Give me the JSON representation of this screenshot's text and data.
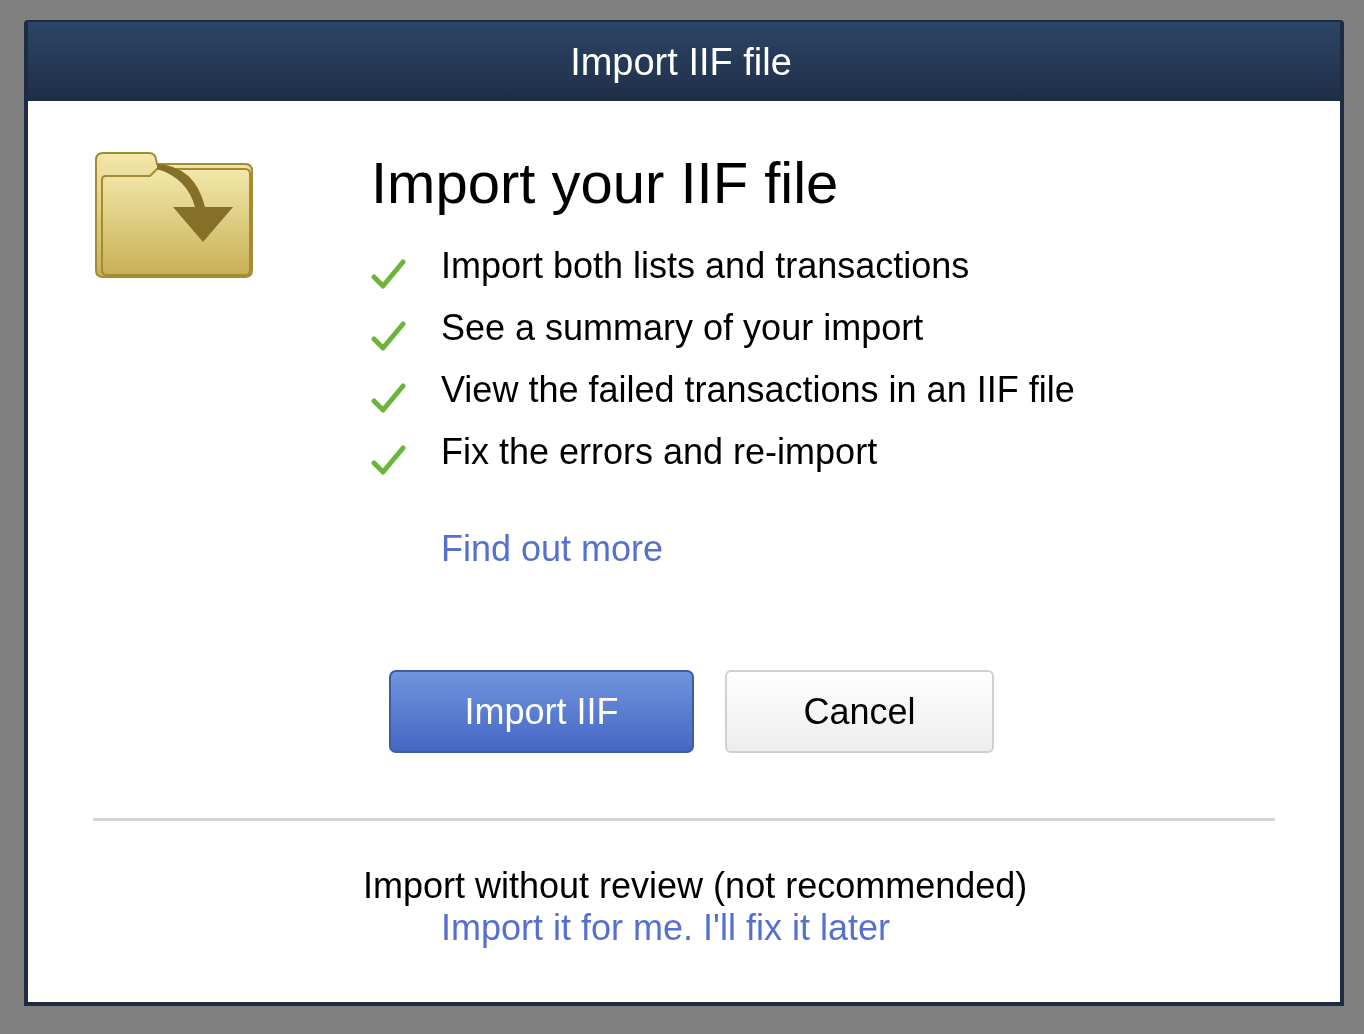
{
  "window": {
    "title": "Import IIF file"
  },
  "heading": "Import your IIF file",
  "features": [
    {
      "text": "Import both lists and transactions",
      "checked": true
    },
    {
      "text": "See a summary of your import",
      "checked": true
    },
    {
      "text": "View the failed transactions in an IIF file",
      "checked": true
    },
    {
      "text": "Fix the errors and re-import",
      "checked": true
    }
  ],
  "link": "Find out more",
  "buttons": [
    {
      "label": "Import IIF",
      "kind": "primary"
    },
    {
      "label": "Cancel",
      "kind": "secondary"
    }
  ],
  "footer": {
    "note": "Import without review (not recommended)",
    "link": "Import it for me. I'll fix it later"
  }
}
